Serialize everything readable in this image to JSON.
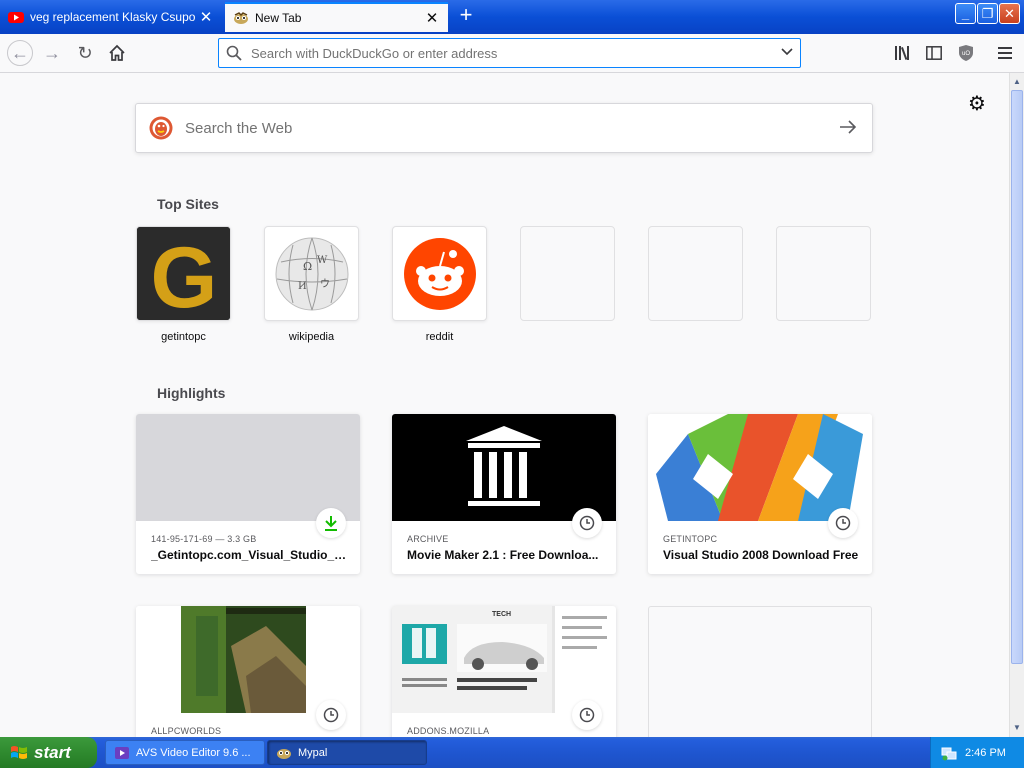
{
  "window": {
    "tabs": [
      {
        "label": "veg replacement Klasky Csupo - Yo",
        "favicon": "youtube-icon",
        "active": false
      },
      {
        "label": "New Tab",
        "favicon": "mypal-icon",
        "active": true
      }
    ]
  },
  "toolbar": {
    "url_placeholder": "Search with DuckDuckGo or enter address"
  },
  "newtab": {
    "search_placeholder": "Search the Web",
    "top_sites_title": "Top Sites",
    "top_sites": [
      {
        "label": "getintopc"
      },
      {
        "label": "wikipedia"
      },
      {
        "label": "reddit"
      },
      {
        "label": ""
      },
      {
        "label": ""
      },
      {
        "label": ""
      }
    ],
    "highlights_title": "Highlights",
    "highlights": [
      {
        "source": "141-95-171-69 — 3.3 GB",
        "title": "_Getintopc.com_Visual_Studio_2...",
        "badge": "download-icon"
      },
      {
        "source": "ARCHIVE",
        "title": "Movie Maker 2.1 : Free Downloa...",
        "badge": "clock-icon"
      },
      {
        "source": "GETINTOPC",
        "title": "Visual Studio 2008 Download Free",
        "badge": "clock-icon"
      },
      {
        "source": "ALLPCWORLDS",
        "title": "",
        "badge": "clock-icon"
      },
      {
        "source": "ADDONS.MOZILLA",
        "title": "",
        "badge": "clock-icon"
      },
      {
        "source": "",
        "title": "",
        "badge": ""
      }
    ]
  },
  "taskbar": {
    "start_label": "start",
    "tasks": [
      {
        "label": "AVS Video Editor 9.6 ..."
      },
      {
        "label": "Mypal"
      }
    ],
    "clock": "2:46 PM"
  },
  "colors": {
    "accent": "#0a84ff",
    "reddit": "#ff4500",
    "getintopc_gold": "#d4a017",
    "download_green": "#12bc00"
  }
}
